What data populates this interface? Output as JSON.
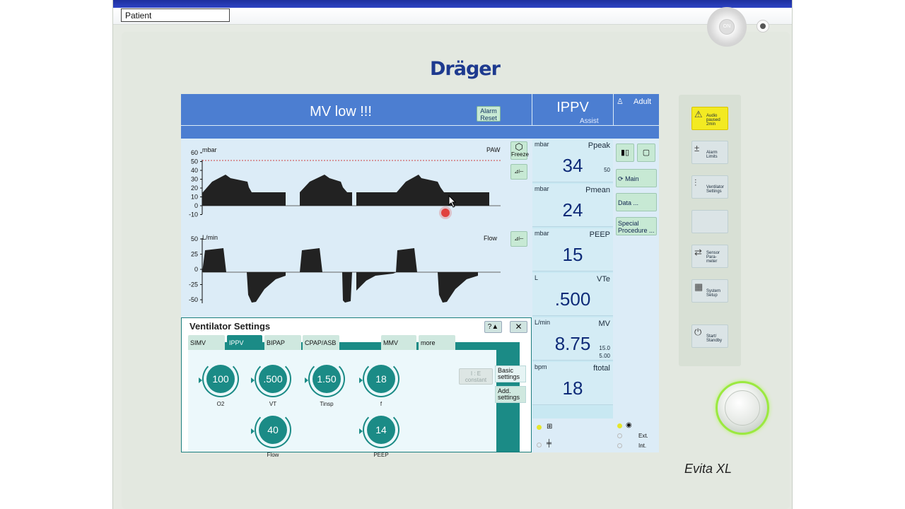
{
  "window": {
    "patient_field": "Patient"
  },
  "device": {
    "brand": "Dräger",
    "model": "Evita XL"
  },
  "header": {
    "alarm_message": "MV low !!!",
    "alarm_reset_line1": "Alarm",
    "alarm_reset_line2": "Reset",
    "mode": "IPPV",
    "mode_sub": "Assist",
    "patient_type": "Adult"
  },
  "waves": {
    "paw": {
      "unit": "mbar",
      "label": "PAW",
      "ticks": [
        "60",
        "50",
        "40",
        "30",
        "20",
        "10",
        "0",
        "-10"
      ]
    },
    "flow": {
      "unit": "L/min",
      "label": "Flow",
      "ticks": [
        "50",
        "25",
        "0",
        "-25",
        "-50"
      ]
    },
    "freeze_label": "Freeze"
  },
  "measured": [
    {
      "unit": "mbar",
      "name": "Ppeak",
      "value": "34",
      "limit_high": "50",
      "limit_low": ""
    },
    {
      "unit": "mbar",
      "name": "Pmean",
      "value": "24",
      "limit_high": "",
      "limit_low": ""
    },
    {
      "unit": "mbar",
      "name": "PEEP",
      "value": "15",
      "limit_high": "",
      "limit_low": ""
    },
    {
      "unit": "L",
      "name": "VTe",
      "value": ".500",
      "limit_high": "",
      "limit_low": ""
    },
    {
      "unit": "L/min",
      "name": "MV",
      "value": "8.75",
      "limit_high": "15.0",
      "limit_low": "5.00"
    },
    {
      "unit": "bpm",
      "name": "ftotal",
      "value": "18",
      "limit_high": "",
      "limit_low": ""
    }
  ],
  "menu": {
    "main": "Main",
    "data": "Data ...",
    "special_line1": "Special",
    "special_line2": "Procedure ..."
  },
  "status": {
    "ext": "Ext.",
    "int": "Int."
  },
  "settings": {
    "title": "Ventilator Settings",
    "help": "?▲",
    "close": "✕",
    "tabs": [
      "SIMV",
      "IPPV",
      "BIPAP",
      "CPAP/ASB",
      "MMV",
      "more"
    ],
    "ie_line1": "I : E",
    "ie_line2": "constant",
    "basic_line1": "Basic",
    "basic_line2": "settings",
    "add_line1": "Add.",
    "add_line2": "settings",
    "knobs": [
      {
        "value": "100",
        "label": "O2"
      },
      {
        "value": ".500",
        "label": "VT"
      },
      {
        "value": "1.50",
        "label": "Tinsp"
      },
      {
        "value": "18",
        "label": "f"
      },
      {
        "value": "40",
        "label": "Flow"
      },
      {
        "value": "14",
        "label": "PEEP"
      }
    ]
  },
  "right_panel": {
    "audio": [
      "Audio",
      "paused",
      "2min"
    ],
    "alarm_limits": [
      "Alarm",
      "Limits"
    ],
    "vent_settings": [
      "Ventilator",
      "Settings"
    ],
    "sensor": [
      "Sensor",
      "Para-",
      "meter"
    ],
    "system": [
      "System",
      "Setup"
    ],
    "standby": [
      "Start/",
      "Standby"
    ]
  },
  "colors": {
    "header_blue": "#4c7ed1",
    "teal": "#1b8b86",
    "alarm_yellow": "#f3ea22",
    "rotary_glow": "#9be93f"
  }
}
